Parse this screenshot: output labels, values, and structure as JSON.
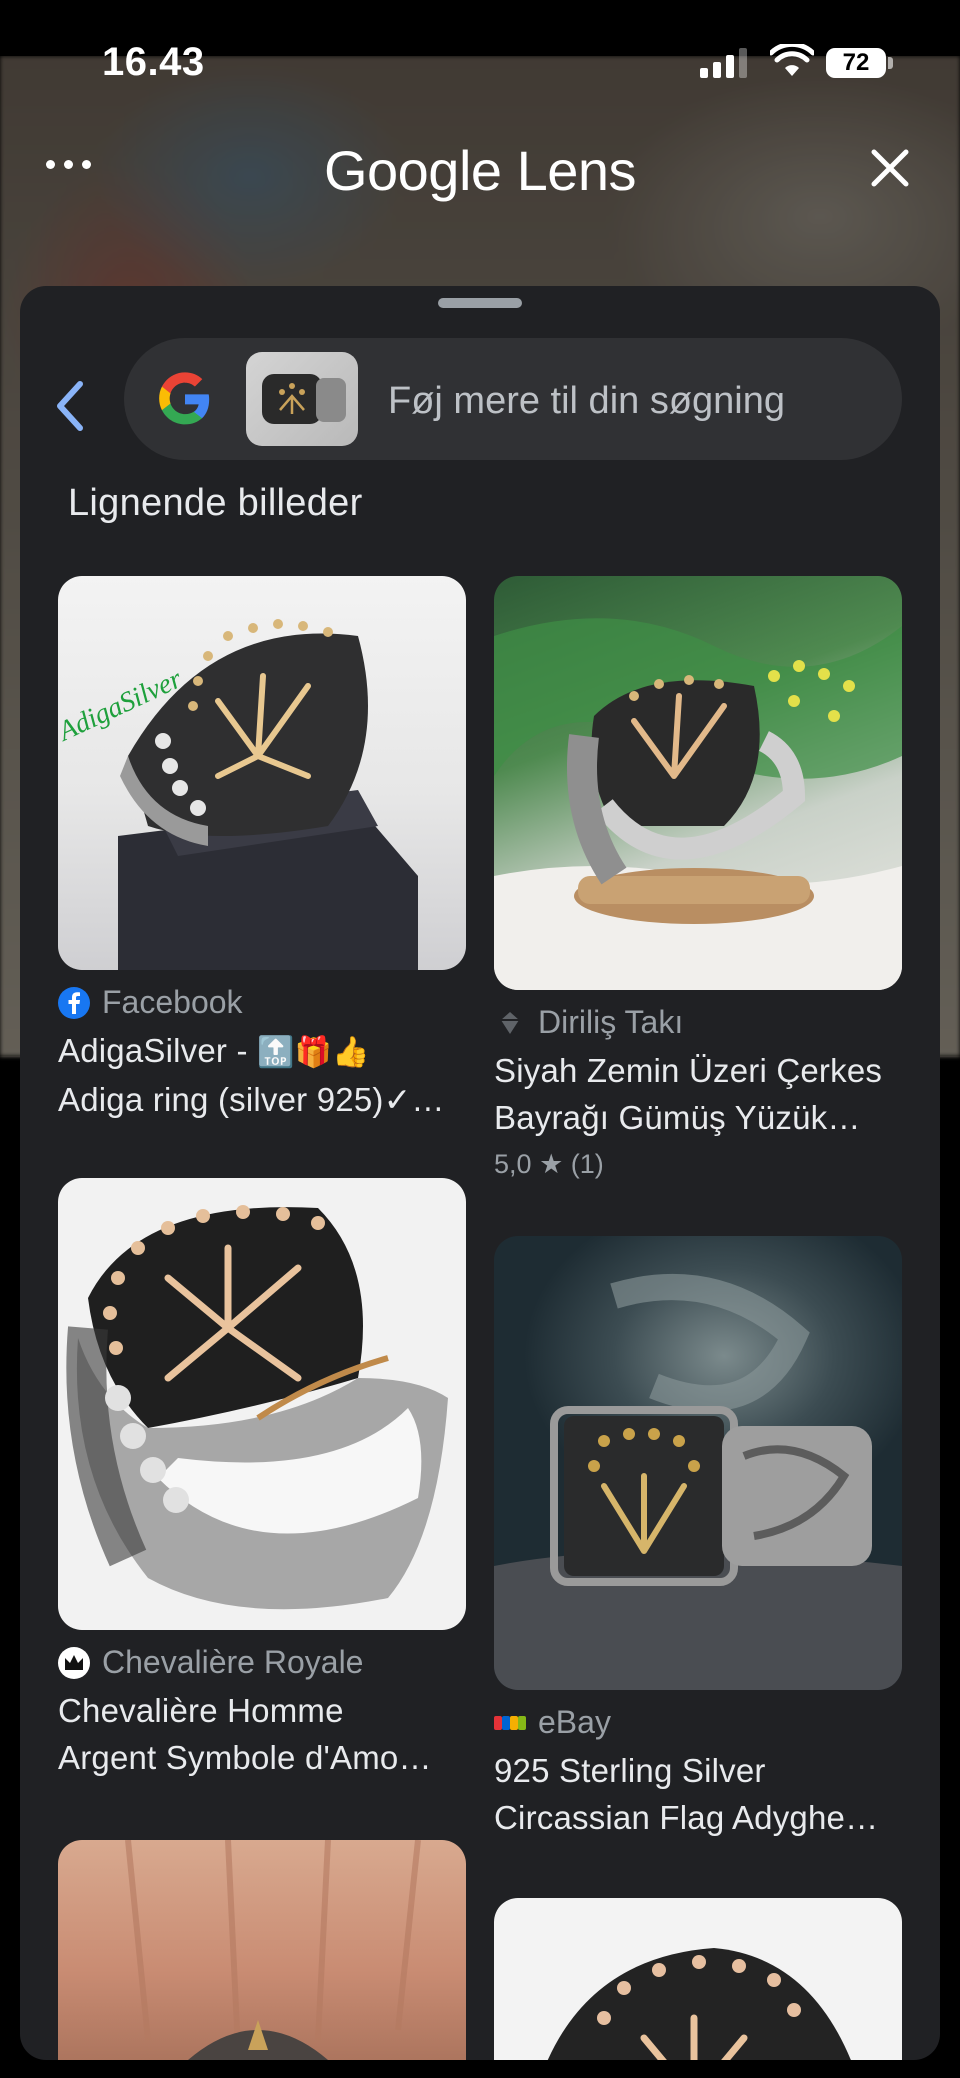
{
  "status_bar": {
    "time": "16.43",
    "battery": "72"
  },
  "header": {
    "title": "Google Lens"
  },
  "search": {
    "placeholder": "Føj mere til din søgning"
  },
  "section": {
    "title": "Lignende billeder"
  },
  "icons": {
    "more": "more-dots-icon",
    "close": "close-icon",
    "back": "back-arrow-icon",
    "google": "google-g-icon",
    "star": "star-icon"
  },
  "colors": {
    "accent_blue": "#8ab4f8",
    "sheet_bg": "#202124",
    "search_bg": "#303134"
  },
  "results": [
    {
      "source": "Facebook",
      "title_line1": "AdigaSilver - ",
      "title_emoji": "🔝🎁👍",
      "title_line2": "Adiga ring (silver 925)✓…",
      "watermark": "AdigaSilver"
    },
    {
      "source": "Diriliş Takı",
      "title_line1": "Siyah Zemin Üzeri Çerkes",
      "title_line2": "Bayrağı Gümüş Yüzük…",
      "rating_value": "5,0",
      "rating_count": "(1)"
    },
    {
      "source": "Chevalière Royale",
      "title_line1": "Chevalière Homme",
      "title_line2": "Argent Symbole d'Amo…"
    },
    {
      "source": "eBay",
      "title_line1": "925 Sterling Silver",
      "title_line2": "Circassian Flag Adyghe…"
    }
  ]
}
